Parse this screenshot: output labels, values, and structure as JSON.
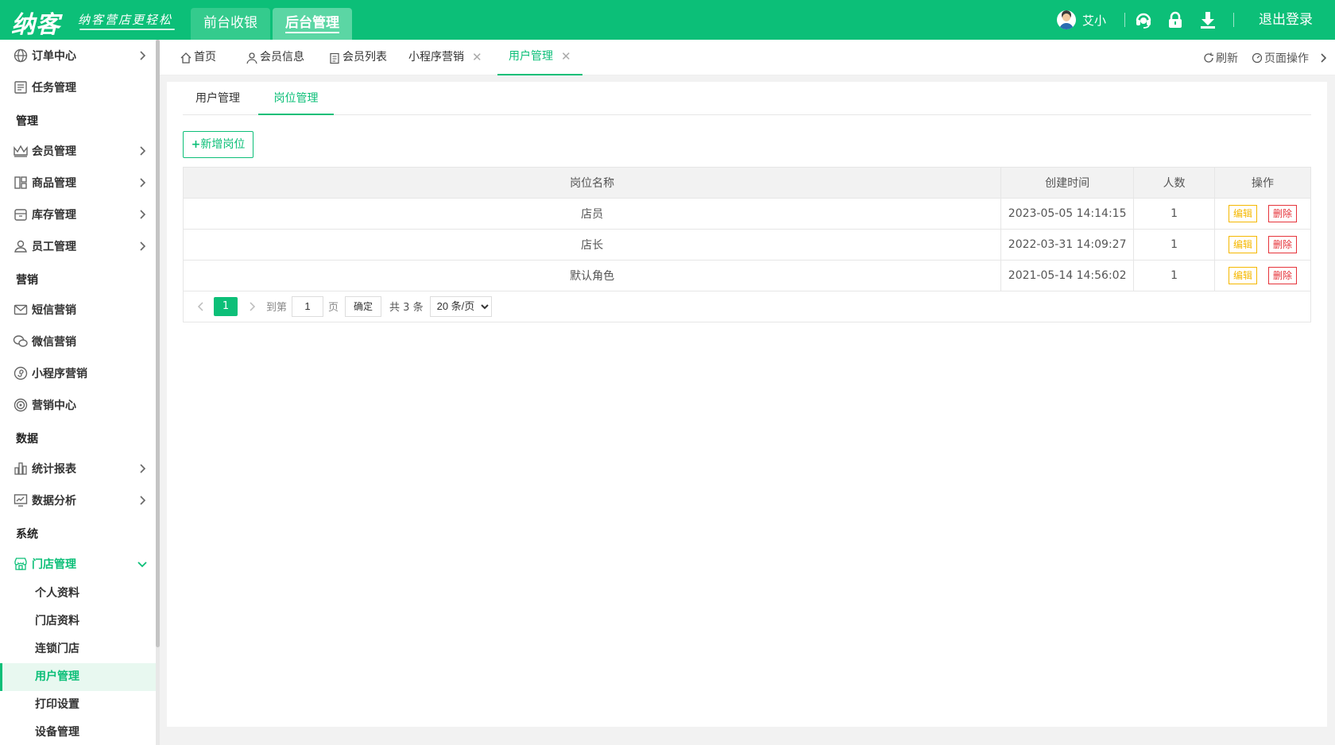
{
  "header": {
    "logo": "纳客",
    "slogan": "纳客营店更轻松",
    "nav_tabs": [
      {
        "label": "前台收银"
      },
      {
        "label": "后台管理"
      }
    ],
    "user_name": "艾小",
    "logout_label": "退出登录"
  },
  "sidebar": {
    "items": [
      {
        "label": "订单中心",
        "icon": "globe-icon"
      },
      {
        "label": "任务管理",
        "icon": "task-icon"
      },
      {
        "group": "管理"
      },
      {
        "label": "会员管理",
        "icon": "crown-icon"
      },
      {
        "label": "商品管理",
        "icon": "layout-icon"
      },
      {
        "label": "库存管理",
        "icon": "box-icon"
      },
      {
        "label": "员工管理",
        "icon": "person-icon"
      },
      {
        "group": "营销"
      },
      {
        "label": "短信营销",
        "icon": "mail-icon"
      },
      {
        "label": "微信营销",
        "icon": "wechat-icon"
      },
      {
        "label": "小程序营销",
        "icon": "miniprogram-icon"
      },
      {
        "label": "营销中心",
        "icon": "target-icon"
      },
      {
        "group": "数据"
      },
      {
        "label": "统计报表",
        "icon": "bar-chart-icon"
      },
      {
        "label": "数据分析",
        "icon": "monitor-chart-icon"
      },
      {
        "group": "系统"
      },
      {
        "label": "门店管理",
        "icon": "store-icon"
      }
    ],
    "sub_items": [
      {
        "label": "个人资料"
      },
      {
        "label": "门店资料"
      },
      {
        "label": "连锁门店"
      },
      {
        "label": "用户管理"
      },
      {
        "label": "打印设置"
      },
      {
        "label": "设备管理"
      }
    ]
  },
  "page_tabs": [
    {
      "label": "首页"
    },
    {
      "label": "会员信息"
    },
    {
      "label": "会员列表"
    },
    {
      "label": "小程序营销"
    },
    {
      "label": "用户管理"
    }
  ],
  "tab_actions": {
    "refresh": "刷新",
    "page_ops": "页面操作"
  },
  "sub_tabs": [
    {
      "label": "用户管理"
    },
    {
      "label": "岗位管理"
    }
  ],
  "add_button": "新增岗位",
  "table": {
    "columns": [
      "岗位名称",
      "创建时间",
      "人数",
      "操作"
    ],
    "rows": [
      {
        "name": "店员",
        "created": "2023-05-05 14:14:15",
        "count": "1"
      },
      {
        "name": "店长",
        "created": "2022-03-31 14:09:27",
        "count": "1"
      },
      {
        "name": "默认角色",
        "created": "2021-05-14 14:56:02",
        "count": "1"
      }
    ],
    "edit_label": "编辑",
    "delete_label": "删除"
  },
  "pager": {
    "current": "1",
    "goto_label": "到第",
    "goto_value": "1",
    "page_label": "页",
    "ok_label": "确定",
    "total": "共 3 条",
    "page_size": "20 条/页"
  },
  "colors": {
    "accent": "#0cbf78",
    "edit": "#f5b800",
    "delete": "#e6333a"
  }
}
